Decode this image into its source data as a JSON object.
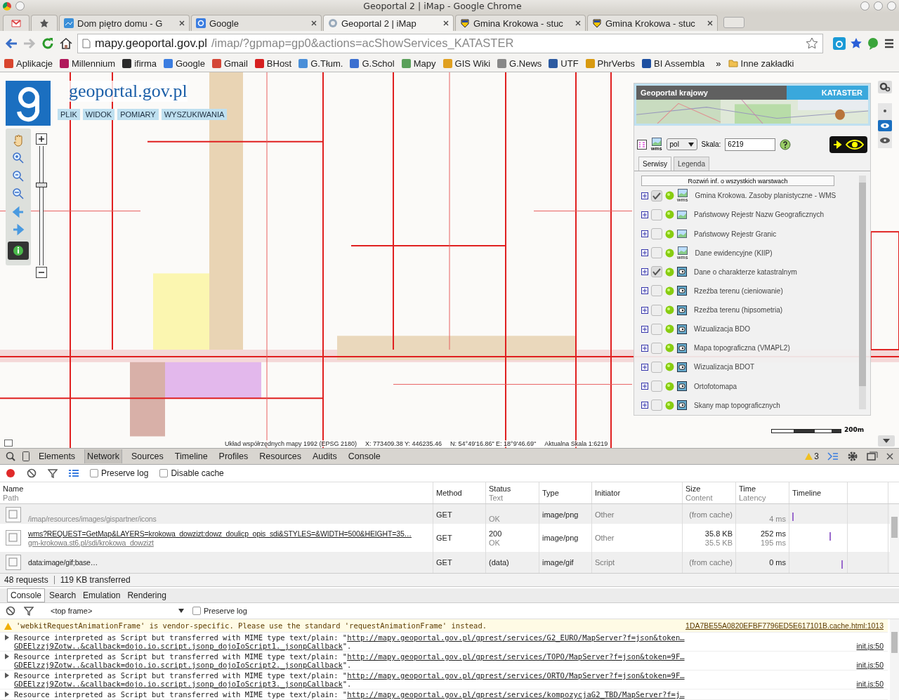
{
  "window": {
    "title": "Geoportal 2 | iMap - Google Chrome"
  },
  "tabs": [
    {
      "kind": "gmail",
      "selected": false
    },
    {
      "kind": "star",
      "selected": false
    },
    {
      "kind": "page",
      "label": "Dom piętro domu - G",
      "selected": false
    },
    {
      "kind": "google",
      "label": "Google",
      "selected": false
    },
    {
      "kind": "geoportal",
      "label": "Geoportal 2 | iMap",
      "selected": true
    },
    {
      "kind": "crest",
      "label": "Gmina Krokowa - stuc",
      "selected": false
    },
    {
      "kind": "crest",
      "label": "Gmina Krokowa - stuc",
      "selected": false
    }
  ],
  "address": {
    "host": "mapy.geoportal.gov.pl",
    "path": "/imap/?gpmap=gp0&actions=acShowServices_KATASTER"
  },
  "bookmarks": [
    {
      "label": "Aplikacje",
      "color": "#d8452e"
    },
    {
      "label": "Millennium",
      "color": "#b0185a"
    },
    {
      "label": "ifirma",
      "color": "#2a2a2a"
    },
    {
      "label": "Google",
      "color": "#3b7de0"
    },
    {
      "label": "Gmail",
      "color": "#d44637"
    },
    {
      "label": "BHost",
      "color": "#d61f1f"
    },
    {
      "label": "G.Tłum.",
      "color": "#4a8fd8"
    },
    {
      "label": "G.Schol",
      "color": "#3b6fd0"
    },
    {
      "label": "Mapy",
      "color": "#5aa05a"
    },
    {
      "label": "GIS Wiki",
      "color": "#e0a020"
    },
    {
      "label": "G.News",
      "color": "#888888"
    },
    {
      "label": "UTF",
      "color": "#2c5aa0"
    },
    {
      "label": "PhrVerbs",
      "color": "#d89a10"
    },
    {
      "label": "BI Assembla",
      "color": "#1d4fa0"
    }
  ],
  "bookmarks_more": "»",
  "other_bookmarks": "Inne zakładki",
  "map": {
    "site_title": "geoportal.gov.pl",
    "menu": [
      "PLIK",
      "WIDOK",
      "POMIARY",
      "WYSZUKIWANIA"
    ],
    "zoom_slider": {
      "level": 0.65
    },
    "panel": {
      "title": "Geoportal krajowy",
      "badge": "KATASTER",
      "language": "pol",
      "scale_label": "Skala:",
      "scale_value": "6219",
      "toolbar_icon_label": "wms",
      "tabs": [
        {
          "label": "Serwisy",
          "selected": true
        },
        {
          "label": "Legenda",
          "selected": false
        }
      ],
      "expand_button": "Rozwiń inf. o wszystkich warstwach",
      "layers": [
        {
          "name": "Gmina Krokowa. Zasoby planistyczne - WMS",
          "checked": true,
          "icon_label": "wms"
        },
        {
          "name": "Państwowy Rejestr Nazw Geograficznych",
          "checked": false
        },
        {
          "name": "Państwowy Rejestr Granic",
          "checked": false
        },
        {
          "name": "Dane ewidencyjne (KIIP)",
          "checked": false,
          "icon_label": "wms"
        },
        {
          "name": "Dane o charakterze katastralnym",
          "checked": true,
          "kind": "cache"
        },
        {
          "name": "Rzeźba terenu (cieniowanie)",
          "checked": false,
          "kind": "cache"
        },
        {
          "name": "Rzeźba terenu (hipsometria)",
          "checked": false,
          "kind": "cache"
        },
        {
          "name": "Wizualizacja BDO",
          "checked": false,
          "kind": "cache"
        },
        {
          "name": "Mapa topograficzna (VMAPL2)",
          "checked": false,
          "kind": "cache"
        },
        {
          "name": "Wizualizacja BDOT",
          "checked": false,
          "kind": "cache"
        },
        {
          "name": "Ortofotomapa",
          "checked": false,
          "kind": "cache"
        },
        {
          "name": "Skany map topograficznych",
          "checked": false,
          "kind": "cache"
        }
      ]
    },
    "scale_bar_label": "200m",
    "coords": [
      "Układ współrzędnych mapy 1992 (EPSG 2180)",
      "X: 773409.38 Y: 446235.46",
      "N: 54°49'16.86\" E: 18°9'46.69\"",
      "Aktualna Skala 1:6219"
    ]
  },
  "devtools": {
    "tabs": [
      {
        "label": "Elements",
        "selected": false
      },
      {
        "label": "Network",
        "selected": true
      },
      {
        "label": "Sources",
        "selected": false
      },
      {
        "label": "Timeline",
        "selected": false
      },
      {
        "label": "Profiles",
        "selected": false
      },
      {
        "label": "Resources",
        "selected": false
      },
      {
        "label": "Audits",
        "selected": false
      },
      {
        "label": "Console",
        "selected": false
      }
    ],
    "warning_count": "3",
    "network_options": [
      {
        "label": "Preserve log",
        "checked": false
      },
      {
        "label": "Disable cache",
        "checked": false
      }
    ],
    "columns": [
      {
        "title": "Name",
        "subtitle": "Path"
      },
      {
        "title": "Method"
      },
      {
        "title": "Status",
        "subtitle": "Text"
      },
      {
        "title": "Type"
      },
      {
        "title": "Initiator"
      },
      {
        "title": "Size",
        "subtitle": "Content"
      },
      {
        "title": "Time",
        "subtitle": "Latency"
      },
      {
        "title": "Timeline"
      }
    ],
    "rows": [
      {
        "name": "",
        "path": "/imap/resources/images/gispartner/icons",
        "method": "GET",
        "status": "",
        "status_text": "OK",
        "type": "image/png",
        "initiator": "Other",
        "size": "(from cache)",
        "content": "",
        "time": "",
        "latency": "4 ms",
        "link": false
      },
      {
        "name": "wms?REQUEST=GetMap&LAYERS=krokowa_dowzizt:dowz_doulicp_opis_sdi&STYLES=&WIDTH=500&HEIGHT=35…",
        "path": "gm-krokowa.st6.pl/sdi/krokowa_dowzizt",
        "method": "GET",
        "status": "200",
        "status_text": "OK",
        "type": "image/png",
        "initiator": "Other",
        "size": "35.8 KB",
        "content": "35.5 KB",
        "time": "252 ms",
        "latency": "195 ms",
        "link": true
      },
      {
        "name": "data:image/gif;base…",
        "path": "",
        "method": "GET",
        "status": "(data)",
        "status_text": "",
        "type": "image/gif",
        "initiator": "Script",
        "size": "(from cache)",
        "content": "",
        "time": "0 ms",
        "latency": "",
        "link": false
      }
    ],
    "summary": [
      "48 requests",
      "119 KB transferred"
    ],
    "drawer_tabs": [
      {
        "label": "Console",
        "selected": true
      },
      {
        "label": "Search",
        "selected": false
      },
      {
        "label": "Emulation",
        "selected": false
      },
      {
        "label": "Rendering",
        "selected": false
      }
    ],
    "frame": "<top frame>",
    "console_preserve": {
      "label": "Preserve log",
      "checked": false
    },
    "messages": [
      {
        "kind": "warning",
        "text": "'webkitRequestAnimationFrame' is vendor-specific. Please use the standard 'requestAnimationFrame' instead.",
        "source": "1DA7BE55A0820EFBF7796ED5E617101B.cache.html:1013"
      },
      {
        "kind": "resource",
        "text": "Resource interpreted as Script but transferred with MIME type text/plain: \"",
        "url": "http://mapy.geoportal.gov.pl/gprest/services/G2_EURO/MapServer?f=json&token…",
        "url2": "GDEElzzj9Zotw..&callback=dojo.io.script.jsonp_dojoIoScript1._jsonpCallback",
        "end": "\".",
        "source": "init.js:50"
      },
      {
        "kind": "resource",
        "text": "Resource interpreted as Script but transferred with MIME type text/plain: \"",
        "url": "http://mapy.geoportal.gov.pl/gprest/services/TOPO/MapServer?f=json&token=9F…",
        "url2": "GDEElzzj9Zotw..&callback=dojo.io.script.jsonp_dojoIoScript2._jsonpCallback",
        "end": "\".",
        "source": "init.js:50"
      },
      {
        "kind": "resource",
        "text": "Resource interpreted as Script but transferred with MIME type text/plain: \"",
        "url": "http://mapy.geoportal.gov.pl/gprest/services/ORTO/MapServer?f=json&token=9F…",
        "url2": "GDEElzzj9Zotw..&callback=dojo.io.script.jsonp_dojoIoScript3._jsonpCallback",
        "end": "\".",
        "source": "init.js:50"
      },
      {
        "kind": "resource",
        "text": "Resource interpreted as Script but transferred with MIME type text/plain: \"",
        "url": "http://mapy.geoportal.gov.pl/gprest/services/kompozycjaG2_TBD/MapServer?f=j…"
      }
    ]
  }
}
